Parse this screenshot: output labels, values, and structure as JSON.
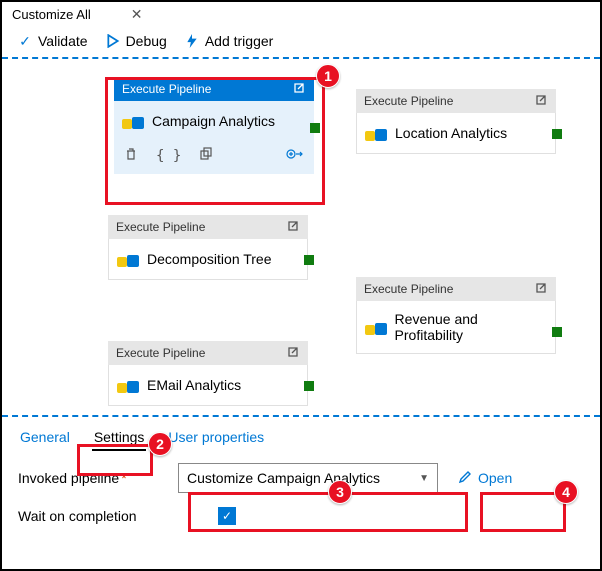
{
  "header": {
    "title": "Customize All"
  },
  "toolbar": {
    "validate": "Validate",
    "debug": "Debug",
    "addTrigger": "Add trigger"
  },
  "nodes": {
    "typeLabel": "Execute Pipeline",
    "items": [
      {
        "label": "Campaign Analytics"
      },
      {
        "label": "Location Analytics"
      },
      {
        "label": "Decomposition Tree"
      },
      {
        "label": "Revenue and Profitability"
      },
      {
        "label": "EMail Analytics"
      }
    ]
  },
  "tabs": {
    "general": "General",
    "settings": "Settings",
    "userProps": "User properties"
  },
  "form": {
    "invokedLabel": "Invoked pipeline",
    "invokedValue": "Customize Campaign Analytics",
    "openLabel": "Open",
    "waitLabel": "Wait on completion"
  },
  "badges": {
    "b1": "1",
    "b2": "2",
    "b3": "3",
    "b4": "4"
  }
}
